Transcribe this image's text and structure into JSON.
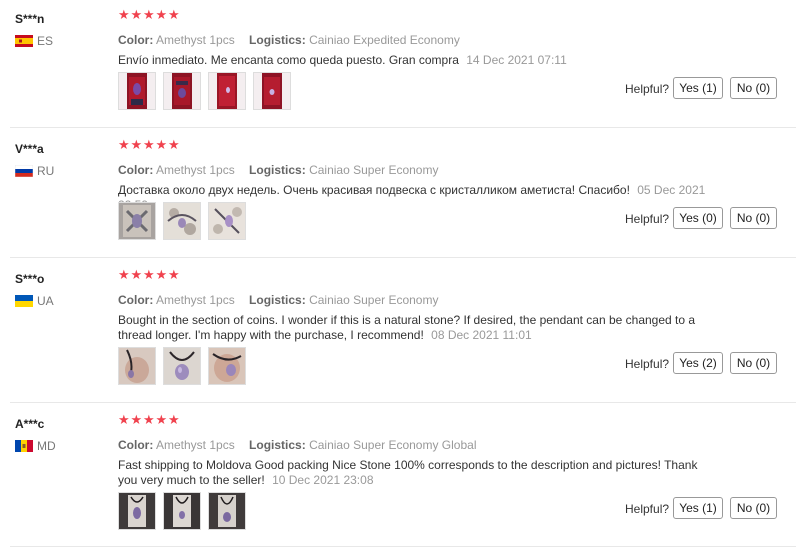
{
  "reviews": [
    {
      "user": "S***n",
      "country": "ES",
      "flag": "spain-flag",
      "rating": 5,
      "color_label": "Color:",
      "color_value": "Amethyst 1pcs",
      "logistics_label": "Logistics:",
      "logistics_value": "Cainiao Expedited Economy",
      "text": "Envío inmediato. Me encanta como queda puesto. Gran compra",
      "date": "14 Dec 2021 07:11",
      "photos": 4,
      "helpful_label": "Helpful?",
      "yes_label": "Yes (1)",
      "no_label": "No (0)"
    },
    {
      "user": "V***a",
      "country": "RU",
      "flag": "russia-flag",
      "rating": 5,
      "color_label": "Color:",
      "color_value": "Amethyst 1pcs",
      "logistics_label": "Logistics:",
      "logistics_value": "Cainiao Super Economy",
      "text": "Доставка около двух недель. Очень красивая подвеска с кристалликом аметиста! Спасибо!",
      "date": "05 Dec 2021 22:59",
      "photos": 3,
      "helpful_label": "Helpful?",
      "yes_label": "Yes (0)",
      "no_label": "No (0)"
    },
    {
      "user": "S***o",
      "country": "UA",
      "flag": "ukraine-flag",
      "rating": 5,
      "color_label": "Color:",
      "color_value": "Amethyst 1pcs",
      "logistics_label": "Logistics:",
      "logistics_value": "Cainiao Super Economy",
      "text": "Bought in the section of coins. I wonder if this is a natural stone? If desired, the pendant can be changed to a thread longer. I'm happy with the purchase, I recommend!",
      "date": "08 Dec 2021 11:01",
      "photos": 3,
      "helpful_label": "Helpful?",
      "yes_label": "Yes (2)",
      "no_label": "No (0)"
    },
    {
      "user": "A***c",
      "country": "MD",
      "flag": "moldova-flag",
      "rating": 5,
      "color_label": "Color:",
      "color_value": "Amethyst 1pcs",
      "logistics_label": "Logistics:",
      "logistics_value": "Cainiao Super Economy Global",
      "text": "Fast shipping to Moldova Good packing Nice Stone 100% corresponds to the description and pictures! Thank you very much to the seller!",
      "date": "10 Dec 2021 23:08",
      "photos": 3,
      "helpful_label": "Helpful?",
      "yes_label": "Yes (1)",
      "no_label": "No (0)"
    }
  ],
  "colors": {
    "star": "#f0424e",
    "meta_gray": "#999999",
    "separator": "#e8e8e8"
  }
}
